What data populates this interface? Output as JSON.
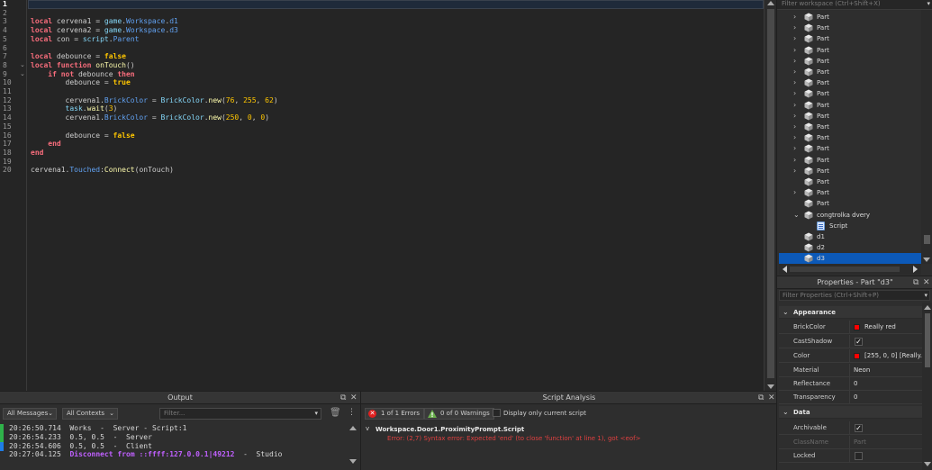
{
  "editor": {
    "line_numbers": [
      "1",
      "2",
      "3",
      "4",
      "5",
      "6",
      "7",
      "8",
      "9",
      "10",
      "11",
      "12",
      "13",
      "14",
      "15",
      "16",
      "17",
      "18",
      "19",
      "20"
    ],
    "lines": [
      [],
      [],
      [
        [
          "kw",
          "local"
        ],
        [
          "id",
          " cervena1 "
        ],
        [
          "op",
          "="
        ],
        [
          "gl",
          " game"
        ],
        [
          "op",
          "."
        ],
        [
          "mem",
          "Workspace"
        ],
        [
          "op",
          "."
        ],
        [
          "mem",
          "d1"
        ]
      ],
      [
        [
          "kw",
          "local"
        ],
        [
          "id",
          " cervena2 "
        ],
        [
          "op",
          "="
        ],
        [
          "gl",
          " game"
        ],
        [
          "op",
          "."
        ],
        [
          "mem",
          "Workspace"
        ],
        [
          "op",
          "."
        ],
        [
          "mem",
          "d3"
        ]
      ],
      [
        [
          "kw",
          "local"
        ],
        [
          "id",
          " con "
        ],
        [
          "op",
          "="
        ],
        [
          "gl",
          " script"
        ],
        [
          "op",
          "."
        ],
        [
          "mem",
          "Parent"
        ]
      ],
      [],
      [
        [
          "kw",
          "local"
        ],
        [
          "id",
          " debounce "
        ],
        [
          "op",
          "="
        ],
        [
          "bool",
          " false"
        ]
      ],
      [
        [
          "kw",
          "local function"
        ],
        [
          "fn",
          " onTouch"
        ],
        [
          "op",
          "()"
        ]
      ],
      [
        [
          "kw",
          "    if not"
        ],
        [
          "id",
          " debounce "
        ],
        [
          "kw",
          "then"
        ]
      ],
      [
        [
          "id",
          "        debounce "
        ],
        [
          "op",
          "="
        ],
        [
          "bool",
          " true"
        ]
      ],
      [],
      [
        [
          "id",
          "        cervena1"
        ],
        [
          "op",
          "."
        ],
        [
          "mem",
          "BrickColor"
        ],
        [
          "op",
          " = "
        ],
        [
          "gl",
          "BrickColor"
        ],
        [
          "op",
          "."
        ],
        [
          "fn",
          "new"
        ],
        [
          "op",
          "("
        ],
        [
          "num",
          "76"
        ],
        [
          "op",
          ", "
        ],
        [
          "num",
          "255"
        ],
        [
          "op",
          ", "
        ],
        [
          "num",
          "62"
        ],
        [
          "op",
          ")"
        ]
      ],
      [
        [
          "gl",
          "        task"
        ],
        [
          "op",
          "."
        ],
        [
          "fn",
          "wait"
        ],
        [
          "op",
          "("
        ],
        [
          "num",
          "3"
        ],
        [
          "op",
          ")"
        ]
      ],
      [
        [
          "id",
          "        cervena1"
        ],
        [
          "op",
          "."
        ],
        [
          "mem",
          "BrickColor"
        ],
        [
          "op",
          " = "
        ],
        [
          "gl",
          "BrickColor"
        ],
        [
          "op",
          "."
        ],
        [
          "fn",
          "new"
        ],
        [
          "op",
          "("
        ],
        [
          "num",
          "250"
        ],
        [
          "op",
          ", "
        ],
        [
          "num",
          "0"
        ],
        [
          "op",
          ", "
        ],
        [
          "num",
          "0"
        ],
        [
          "op",
          ")"
        ]
      ],
      [],
      [
        [
          "id",
          "        debounce "
        ],
        [
          "op",
          "="
        ],
        [
          "bool",
          " false"
        ]
      ],
      [
        [
          "kw",
          "    end"
        ]
      ],
      [
        [
          "kw",
          "end"
        ]
      ],
      [],
      [
        [
          "id",
          "cervena1"
        ],
        [
          "op",
          "."
        ],
        [
          "mem",
          "Touched"
        ],
        [
          "op",
          ":"
        ],
        [
          "fn",
          "Connect"
        ],
        [
          "op",
          "(onTouch)"
        ]
      ]
    ]
  },
  "output": {
    "title": "Output",
    "all_messages": "All Messages",
    "all_contexts": "All Contexts",
    "filter_placeholder": "Filter...",
    "logs": [
      {
        "text": "20:26:50.714  Works  -  Server - Script:1",
        "bar": "#2fb24a"
      },
      {
        "text": "20:26:54.233  0.5, 0.5  -  Server",
        "bar": "#2fb24a"
      },
      {
        "text": "20:26:54.606  0.5, 0.5  -  Client",
        "bar": "#1f7de6"
      },
      {
        "time": "20:27:04.125  ",
        "purple": "Disconnect from ::ffff:127.0.0.1|49212",
        "tail": "  -  Studio",
        "bar": ""
      }
    ]
  },
  "analysis": {
    "title": "Script Analysis",
    "errors_label": "1 of 1 Errors",
    "warnings_label": "0 of 0 Warnings",
    "display_only": "Display only current script",
    "path": "Workspace.Door1.ProximityPrompt.Script",
    "error_text": "Error: (2,7) Syntax error: Expected 'end' (to close 'function' at line 1), got <eof>"
  },
  "explorer": {
    "filter_placeholder": "Filter workspace (Ctrl+Shift+X)",
    "items": [
      {
        "label": "Part",
        "chevron": ">",
        "icon": "part-icon",
        "indent": 1
      },
      {
        "label": "Part",
        "chevron": ">",
        "icon": "part-icon",
        "indent": 1
      },
      {
        "label": "Part",
        "chevron": ">",
        "icon": "part-icon",
        "indent": 1
      },
      {
        "label": "Part",
        "chevron": ">",
        "icon": "part-icon",
        "indent": 1
      },
      {
        "label": "Part",
        "chevron": ">",
        "icon": "part-icon",
        "indent": 1
      },
      {
        "label": "Part",
        "chevron": ">",
        "icon": "part-icon",
        "indent": 1
      },
      {
        "label": "Part",
        "chevron": ">",
        "icon": "part-icon",
        "indent": 1
      },
      {
        "label": "Part",
        "chevron": ">",
        "icon": "part-icon",
        "indent": 1
      },
      {
        "label": "Part",
        "chevron": ">",
        "icon": "part-icon",
        "indent": 1
      },
      {
        "label": "Part",
        "chevron": ">",
        "icon": "part-icon",
        "indent": 1
      },
      {
        "label": "Part",
        "chevron": ">",
        "icon": "part-icon",
        "indent": 1
      },
      {
        "label": "Part",
        "chevron": ">",
        "icon": "part-icon",
        "indent": 1
      },
      {
        "label": "Part",
        "chevron": ">",
        "icon": "part-icon",
        "indent": 1
      },
      {
        "label": "Part",
        "chevron": ">",
        "icon": "part-icon",
        "indent": 1
      },
      {
        "label": "Part",
        "chevron": ">",
        "icon": "part-icon",
        "indent": 1
      },
      {
        "label": "Part",
        "chevron": "",
        "icon": "part-icon",
        "indent": 1
      },
      {
        "label": "Part",
        "chevron": ">",
        "icon": "part-icon",
        "indent": 1
      },
      {
        "label": "Part",
        "chevron": "",
        "icon": "part-icon",
        "indent": 1
      },
      {
        "label": "congtrolka dvery",
        "chevron": "v",
        "icon": "part-icon",
        "indent": 1
      },
      {
        "label": "Script",
        "chevron": "",
        "icon": "script-icon",
        "indent": 2
      },
      {
        "label": "d1",
        "chevron": "",
        "icon": "part-icon",
        "indent": 1
      },
      {
        "label": "d2",
        "chevron": "",
        "icon": "part-icon",
        "indent": 1
      },
      {
        "label": "d3",
        "chevron": "",
        "icon": "part-icon",
        "indent": 1,
        "selected": true
      }
    ]
  },
  "properties": {
    "title": "Properties - Part \"d3\"",
    "filter_placeholder": "Filter Properties (Ctrl+Shift+P)",
    "appearance_label": "Appearance",
    "data_label": "Data",
    "rows": {
      "brickcolor": {
        "name": "BrickColor",
        "value": "Really red"
      },
      "castshadow": {
        "name": "CastShadow",
        "value": "✓"
      },
      "color": {
        "name": "Color",
        "value": "[255, 0, 0] [Really..."
      },
      "material": {
        "name": "Material",
        "value": "Neon"
      },
      "reflectance": {
        "name": "Reflectance",
        "value": "0"
      },
      "transparency": {
        "name": "Transparency",
        "value": "0"
      },
      "archivable": {
        "name": "Archivable",
        "value": "✓"
      },
      "classname": {
        "name": "ClassName",
        "value": "Part"
      },
      "locked": {
        "name": "Locked",
        "value": ""
      }
    },
    "swatch_color": "#ff0000"
  },
  "colors": {
    "accent": "#0c59b8",
    "keyword": "#f86d7c",
    "error": "#e04040",
    "server_bar": "#2fb24a",
    "client_bar": "#1f7de6"
  }
}
